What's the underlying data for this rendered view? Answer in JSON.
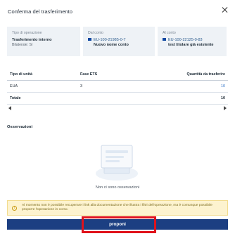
{
  "dialog": {
    "title": "Conferma del trasferimento"
  },
  "info": {
    "operation": {
      "label": "Tipo di operazione",
      "value": "Trasferimento interno",
      "sub": "Bilaterale: Sì"
    },
    "from_account": {
      "label": "Dal conto",
      "number": "EU-100-21985-0-7",
      "name": "Nuovo nome conto"
    },
    "to_account": {
      "label": "Al conto",
      "number": "EU-100-22125-0-83",
      "name": "test titolare già esistente"
    }
  },
  "table": {
    "columns": [
      "Tipo di unità",
      "Fase ETS",
      "Quantità da trasferire"
    ],
    "rows": [
      {
        "type": "EUA",
        "phase": "3",
        "qty": "10"
      }
    ],
    "total": {
      "label": "Totale",
      "qty": "10"
    }
  },
  "observations": {
    "title": "Osservazioni",
    "empty_text": "Non ci sono osservazioni"
  },
  "warning": {
    "icon": "info-icon",
    "text": "Al momento non è possibile recuperare i link alla documentazione che illustra i filtri dell'operazione, ma è comunque possibile proporre l'operazione in corso."
  },
  "actions": {
    "propose_label": "proponi"
  },
  "colors": {
    "primary": "#1c3f82",
    "highlight": "#e0121b",
    "warning_bg": "#fdf3cf"
  }
}
